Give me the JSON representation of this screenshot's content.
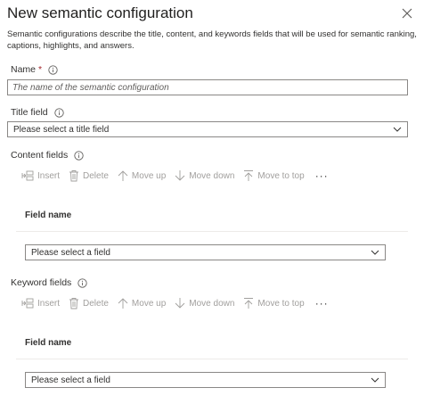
{
  "panel": {
    "title": "New semantic configuration",
    "description": "Semantic configurations describe the title, content, and keywords fields that will be used for semantic ranking, captions, highlights, and answers."
  },
  "name_field": {
    "label": "Name",
    "required_marker": "*",
    "placeholder": "The name of the semantic configuration"
  },
  "title_field": {
    "label": "Title field",
    "selected": "Please select a title field"
  },
  "content_fields": {
    "label": "Content fields",
    "toolbar": {
      "insert": "Insert",
      "delete": "Delete",
      "move_up": "Move up",
      "move_down": "Move down",
      "move_to_top": "Move to top",
      "more": "···"
    },
    "column_header": "Field name",
    "selected": "Please select a field"
  },
  "keyword_fields": {
    "label": "Keyword fields",
    "toolbar": {
      "insert": "Insert",
      "delete": "Delete",
      "move_up": "Move up",
      "move_down": "Move down",
      "move_to_top": "Move to top",
      "more": "···"
    },
    "column_header": "Field name",
    "selected": "Please select a field"
  },
  "icons": [
    "close-icon",
    "info-icon",
    "chevron-down-icon",
    "insert-icon",
    "delete-icon",
    "arrow-up-icon",
    "arrow-down-icon",
    "move-to-top-icon",
    "more-icon"
  ],
  "colors": {
    "text": "#323130",
    "disabled": "#a19f9d",
    "border": "#8a8886",
    "required": "#a4262c"
  }
}
